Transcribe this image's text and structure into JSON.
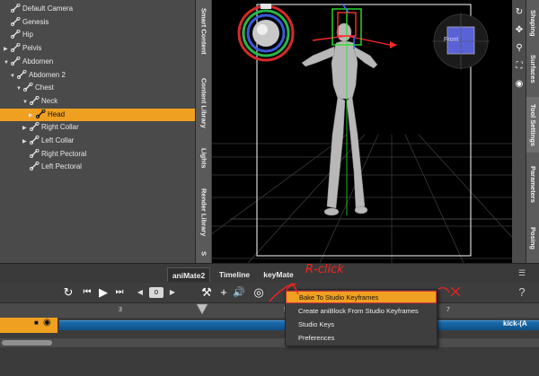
{
  "scene_tree": {
    "items": [
      {
        "label": "Default Camera",
        "toggle": "",
        "selected": false,
        "indent": 0
      },
      {
        "label": "Genesis",
        "toggle": "",
        "selected": false,
        "indent": 0
      },
      {
        "label": "Hip",
        "toggle": "",
        "selected": false,
        "indent": 0
      },
      {
        "label": "Pelvis",
        "toggle": "▶",
        "selected": false,
        "indent": 0
      },
      {
        "label": "Abdomen",
        "toggle": "▼",
        "selected": false,
        "indent": 0
      },
      {
        "label": "Abdomen 2",
        "toggle": "▼",
        "selected": false,
        "indent": 1
      },
      {
        "label": "Chest",
        "toggle": "▼",
        "selected": false,
        "indent": 2
      },
      {
        "label": "Neck",
        "toggle": "▼",
        "selected": false,
        "indent": 3
      },
      {
        "label": "Head",
        "toggle": "▶",
        "selected": true,
        "indent": 4
      },
      {
        "label": "Right Collar",
        "toggle": "▶",
        "selected": false,
        "indent": 3
      },
      {
        "label": "Left Collar",
        "toggle": "▶",
        "selected": false,
        "indent": 3
      },
      {
        "label": "Right Pectoral",
        "toggle": "",
        "selected": false,
        "indent": 3
      },
      {
        "label": "Left Pectoral",
        "toggle": "",
        "selected": false,
        "indent": 3
      }
    ]
  },
  "left_tabs": [
    "Smart Content",
    "Content Library",
    "Lights",
    "Render Library",
    "S"
  ],
  "right_tabs": [
    "Shaping",
    "Surfaces",
    "Tool Settings",
    "Parameters",
    "Posing"
  ],
  "viewport": {
    "cube_label": "Front"
  },
  "timeline": {
    "tabs": [
      "aniMate2",
      "Timeline",
      "keyMate"
    ],
    "active_tab": "aniMate2",
    "frame_value": "0",
    "ruler_ticks": [
      "3",
      "5",
      "7"
    ],
    "block_label": "kick-(A"
  },
  "context_menu": {
    "items": [
      {
        "label": "Bake To Studio Keyframes",
        "highlighted": true
      },
      {
        "label": "Create aniBlock From Studio Keyframes",
        "highlighted": false
      },
      {
        "label": "Studio Keys",
        "highlighted": false
      },
      {
        "label": "Preferences",
        "highlighted": false
      }
    ]
  },
  "annotation": {
    "text": "R-click",
    "color": "#ff2020"
  },
  "colors": {
    "selection": "#f0a020",
    "track": "#1d6fb0",
    "annotation": "#ff2020"
  }
}
